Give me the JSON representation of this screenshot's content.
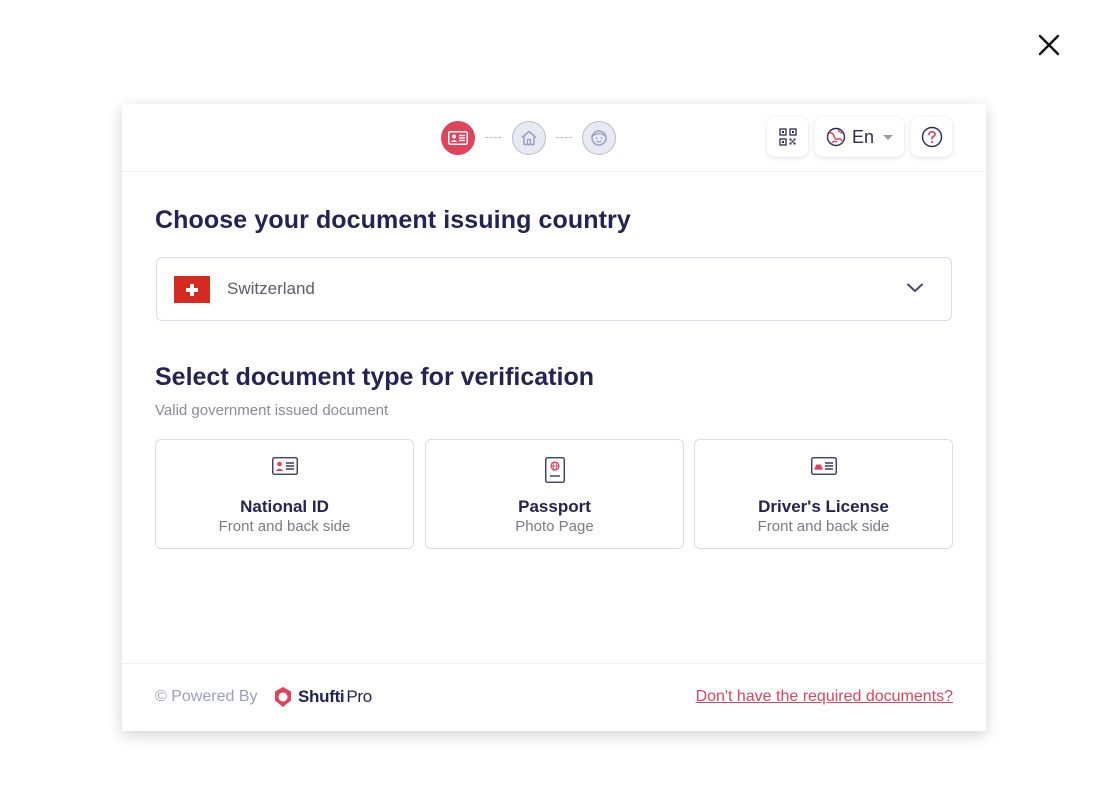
{
  "header": {
    "language": "En",
    "steps": [
      "document",
      "address",
      "face"
    ]
  },
  "country_section": {
    "title": "Choose your document issuing country",
    "selected_country": "Switzerland"
  },
  "document_section": {
    "title": "Select document type for verification",
    "subtitle": "Valid government issued document",
    "options": [
      {
        "title": "National ID",
        "subtitle": "Front and back side",
        "icon": "id-card-icon"
      },
      {
        "title": "Passport",
        "subtitle": "Photo Page",
        "icon": "passport-icon"
      },
      {
        "title": "Driver's License",
        "subtitle": "Front and back side",
        "icon": "drivers-license-icon"
      }
    ]
  },
  "footer": {
    "powered_by": "© Powered By",
    "brand_bold": "Shufti",
    "brand_light": "Pro",
    "missing_docs_link": "Don't have the required documents?"
  },
  "colors": {
    "accent": "#e0435c",
    "heading": "#232355",
    "flag_red": "#d52b1e"
  }
}
